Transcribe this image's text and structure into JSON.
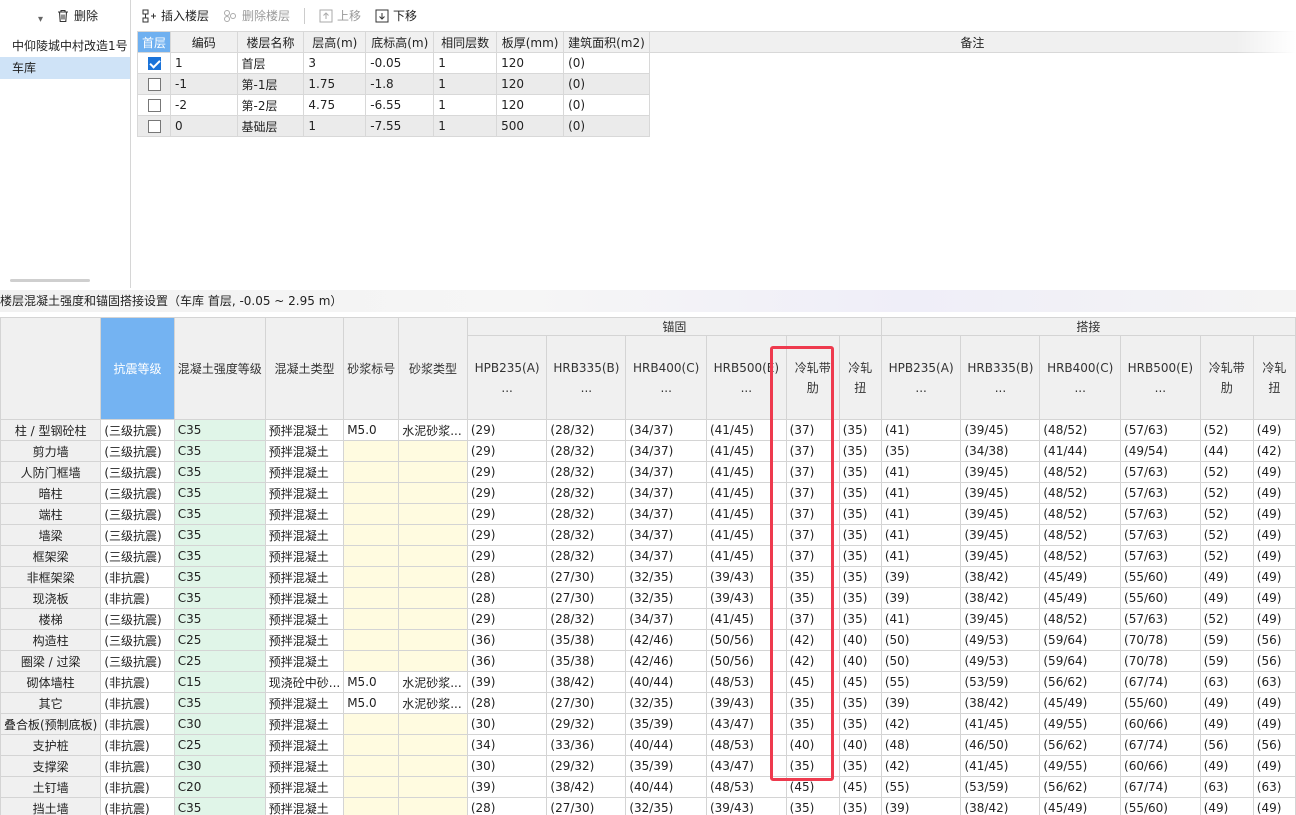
{
  "left_panel": {
    "delete_label": "删除",
    "items": [
      "中仰陵城中村改造1号",
      "车库"
    ],
    "selected_index": 1
  },
  "toolbar": {
    "insert_floor": "插入楼层",
    "delete_floor": "删除楼层",
    "move_up": "上移",
    "move_down": "下移"
  },
  "floor_table": {
    "headers": [
      "首层",
      "编码",
      "楼层名称",
      "层高(m)",
      "底标高(m)",
      "相同层数",
      "板厚(mm)",
      "建筑面积(m2)",
      "备注"
    ],
    "rows": [
      {
        "checked": true,
        "code": "1",
        "name": "首层",
        "height": "3",
        "bottom": "-0.05",
        "same": "1",
        "slab": "120",
        "area": "(0)",
        "note": ""
      },
      {
        "checked": false,
        "code": "-1",
        "name": "第-1层",
        "height": "1.75",
        "bottom": "-1.8",
        "same": "1",
        "slab": "120",
        "area": "(0)",
        "note": ""
      },
      {
        "checked": false,
        "code": "-2",
        "name": "第-2层",
        "height": "4.75",
        "bottom": "-6.55",
        "same": "1",
        "slab": "120",
        "area": "(0)",
        "note": ""
      },
      {
        "checked": false,
        "code": "0",
        "name": "基础层",
        "height": "1",
        "bottom": "-7.55",
        "same": "1",
        "slab": "500",
        "area": "(0)",
        "note": ""
      }
    ]
  },
  "section_title": "楼层混凝土强度和锚固搭接设置（车库 首层, -0.05 ~ 2.95 m）",
  "anchor_table": {
    "group_anchor": "锚固",
    "group_lap": "搭接",
    "headers": [
      "抗震等级",
      "混凝土强度等级",
      "混凝土类型",
      "砂浆标号",
      "砂浆类型",
      "HPB235(A)\n...",
      "HRB335(B)\n...",
      "HRB400(C)\n...",
      "HRB500(E)\n...",
      "冷轧带肋",
      "冷轧扭",
      "HPB235(A)\n...",
      "HRB335(B)\n...",
      "HRB400(C)\n...",
      "HRB500(E)\n...",
      "冷轧带肋",
      "冷轧扭"
    ],
    "rows": [
      [
        "柱 / 型钢砼柱",
        "(三级抗震)",
        "C35",
        "预拌混凝土",
        "M5.0",
        "水泥砂浆...",
        "(29)",
        "(28/32)",
        "(34/37)",
        "(41/45)",
        "(37)",
        "(35)",
        "(41)",
        "(39/45)",
        "(48/52)",
        "(57/63)",
        "(52)",
        "(49)"
      ],
      [
        "剪力墙",
        "(三级抗震)",
        "C35",
        "预拌混凝土",
        "",
        "",
        "(29)",
        "(28/32)",
        "(34/37)",
        "(41/45)",
        "(37)",
        "(35)",
        "(35)",
        "(34/38)",
        "(41/44)",
        "(49/54)",
        "(44)",
        "(42)"
      ],
      [
        "人防门框墙",
        "(三级抗震)",
        "C35",
        "预拌混凝土",
        "",
        "",
        "(29)",
        "(28/32)",
        "(34/37)",
        "(41/45)",
        "(37)",
        "(35)",
        "(41)",
        "(39/45)",
        "(48/52)",
        "(57/63)",
        "(52)",
        "(49)"
      ],
      [
        "暗柱",
        "(三级抗震)",
        "C35",
        "预拌混凝土",
        "",
        "",
        "(29)",
        "(28/32)",
        "(34/37)",
        "(41/45)",
        "(37)",
        "(35)",
        "(41)",
        "(39/45)",
        "(48/52)",
        "(57/63)",
        "(52)",
        "(49)"
      ],
      [
        "端柱",
        "(三级抗震)",
        "C35",
        "预拌混凝土",
        "",
        "",
        "(29)",
        "(28/32)",
        "(34/37)",
        "(41/45)",
        "(37)",
        "(35)",
        "(41)",
        "(39/45)",
        "(48/52)",
        "(57/63)",
        "(52)",
        "(49)"
      ],
      [
        "墙梁",
        "(三级抗震)",
        "C35",
        "预拌混凝土",
        "",
        "",
        "(29)",
        "(28/32)",
        "(34/37)",
        "(41/45)",
        "(37)",
        "(35)",
        "(41)",
        "(39/45)",
        "(48/52)",
        "(57/63)",
        "(52)",
        "(49)"
      ],
      [
        "框架梁",
        "(三级抗震)",
        "C35",
        "预拌混凝土",
        "",
        "",
        "(29)",
        "(28/32)",
        "(34/37)",
        "(41/45)",
        "(37)",
        "(35)",
        "(41)",
        "(39/45)",
        "(48/52)",
        "(57/63)",
        "(52)",
        "(49)"
      ],
      [
        "非框架梁",
        "(非抗震)",
        "C35",
        "预拌混凝土",
        "",
        "",
        "(28)",
        "(27/30)",
        "(32/35)",
        "(39/43)",
        "(35)",
        "(35)",
        "(39)",
        "(38/42)",
        "(45/49)",
        "(55/60)",
        "(49)",
        "(49)"
      ],
      [
        "现浇板",
        "(非抗震)",
        "C35",
        "预拌混凝土",
        "",
        "",
        "(28)",
        "(27/30)",
        "(32/35)",
        "(39/43)",
        "(35)",
        "(35)",
        "(39)",
        "(38/42)",
        "(45/49)",
        "(55/60)",
        "(49)",
        "(49)"
      ],
      [
        "楼梯",
        "(三级抗震)",
        "C35",
        "预拌混凝土",
        "",
        "",
        "(29)",
        "(28/32)",
        "(34/37)",
        "(41/45)",
        "(37)",
        "(35)",
        "(41)",
        "(39/45)",
        "(48/52)",
        "(57/63)",
        "(52)",
        "(49)"
      ],
      [
        "构造柱",
        "(三级抗震)",
        "C25",
        "预拌混凝土",
        "",
        "",
        "(36)",
        "(35/38)",
        "(42/46)",
        "(50/56)",
        "(42)",
        "(40)",
        "(50)",
        "(49/53)",
        "(59/64)",
        "(70/78)",
        "(59)",
        "(56)"
      ],
      [
        "圈梁 / 过梁",
        "(三级抗震)",
        "C25",
        "预拌混凝土",
        "",
        "",
        "(36)",
        "(35/38)",
        "(42/46)",
        "(50/56)",
        "(42)",
        "(40)",
        "(50)",
        "(49/53)",
        "(59/64)",
        "(70/78)",
        "(59)",
        "(56)"
      ],
      [
        "砌体墙柱",
        "(非抗震)",
        "C15",
        "现浇砼中砂...",
        "M5.0",
        "水泥砂浆...",
        "(39)",
        "(38/42)",
        "(40/44)",
        "(48/53)",
        "(45)",
        "(45)",
        "(55)",
        "(53/59)",
        "(56/62)",
        "(67/74)",
        "(63)",
        "(63)"
      ],
      [
        "其它",
        "(非抗震)",
        "C35",
        "预拌混凝土",
        "M5.0",
        "水泥砂浆...",
        "(28)",
        "(27/30)",
        "(32/35)",
        "(39/43)",
        "(35)",
        "(35)",
        "(39)",
        "(38/42)",
        "(45/49)",
        "(55/60)",
        "(49)",
        "(49)"
      ],
      [
        "叠合板(预制底板)",
        "(非抗震)",
        "C30",
        "预拌混凝土",
        "",
        "",
        "(30)",
        "(29/32)",
        "(35/39)",
        "(43/47)",
        "(35)",
        "(35)",
        "(42)",
        "(41/45)",
        "(49/55)",
        "(60/66)",
        "(49)",
        "(49)"
      ],
      [
        "支护桩",
        "(非抗震)",
        "C25",
        "预拌混凝土",
        "",
        "",
        "(34)",
        "(33/36)",
        "(40/44)",
        "(48/53)",
        "(40)",
        "(40)",
        "(48)",
        "(46/50)",
        "(56/62)",
        "(67/74)",
        "(56)",
        "(56)"
      ],
      [
        "支撑梁",
        "(非抗震)",
        "C30",
        "预拌混凝土",
        "",
        "",
        "(30)",
        "(29/32)",
        "(35/39)",
        "(43/47)",
        "(35)",
        "(35)",
        "(42)",
        "(41/45)",
        "(49/55)",
        "(60/66)",
        "(49)",
        "(49)"
      ],
      [
        "土钉墙",
        "(非抗震)",
        "C20",
        "预拌混凝土",
        "",
        "",
        "(39)",
        "(38/42)",
        "(40/44)",
        "(48/53)",
        "(45)",
        "(45)",
        "(55)",
        "(53/59)",
        "(56/62)",
        "(67/74)",
        "(63)",
        "(63)"
      ],
      [
        "挡土墙",
        "(非抗震)",
        "C35",
        "预拌混凝土",
        "",
        "",
        "(28)",
        "(27/30)",
        "(32/35)",
        "(39/43)",
        "(35)",
        "(35)",
        "(39)",
        "(38/42)",
        "(45/49)",
        "(55/60)",
        "(49)",
        "(49)"
      ]
    ]
  }
}
